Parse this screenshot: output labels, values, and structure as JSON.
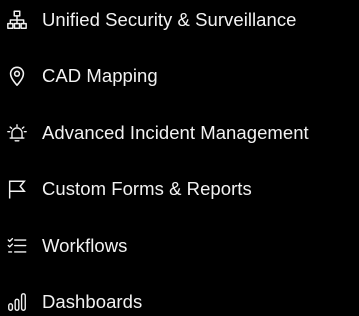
{
  "menu": {
    "items": [
      {
        "label": "Unified Security & Surveillance",
        "icon": "network-icon"
      },
      {
        "label": "CAD Mapping",
        "icon": "map-pin-icon"
      },
      {
        "label": "Advanced Incident Management",
        "icon": "alarm-bell-icon"
      },
      {
        "label": "Custom Forms & Reports",
        "icon": "flag-icon"
      },
      {
        "label": "Workflows",
        "icon": "checklist-icon"
      },
      {
        "label": "Dashboards",
        "icon": "bar-chart-icon"
      }
    ]
  },
  "colors": {
    "background": "#000000",
    "text": "#f2f2f2",
    "icon": "#f2f2f2"
  }
}
